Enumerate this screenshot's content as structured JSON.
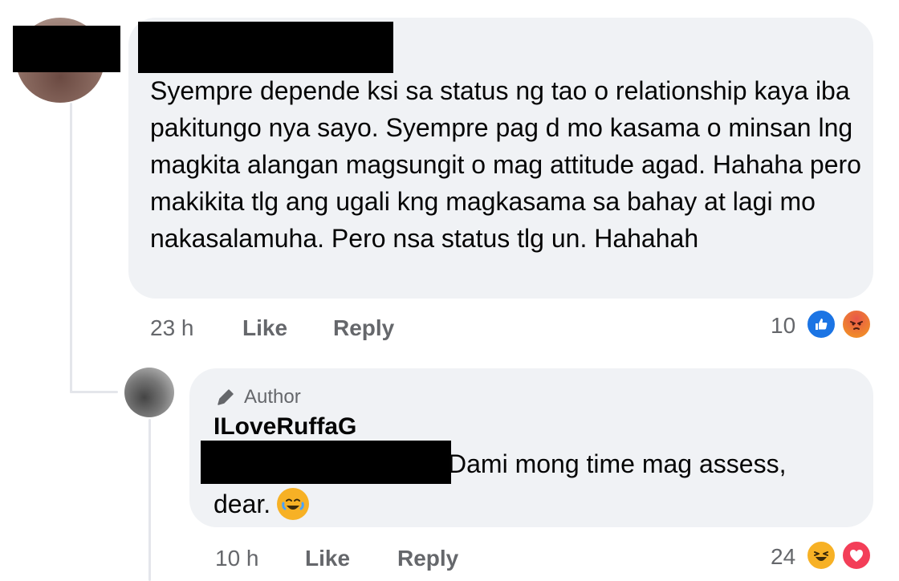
{
  "comment_1": {
    "text": "Syempre depende ksi sa status ng tao o relationship kaya iba pakitungo nya sayo. Syempre pag d mo kasama o minsan lng magkita alangan magsungit o mag attitude agad. Hahaha pero makikita tlg ang ugali kng magkasama sa bahay at lagi mo nakasalamuha. Pero nsa status tlg un. Hahahah",
    "time": "23 h",
    "like_label": "Like",
    "reply_label": "Reply",
    "reaction_count": "10",
    "reactions": [
      "like-icon",
      "angry-icon"
    ]
  },
  "reply_1": {
    "author_badge": "Author",
    "author_name": "ILoveRuffaG",
    "text_line1": "Dami mong time mag assess,",
    "text_line2": "dear.",
    "emoji": "laugh-cry-icon",
    "time": "10 h",
    "like_label": "Like",
    "reply_label": "Reply",
    "reaction_count": "24",
    "reactions": [
      "haha-icon",
      "love-icon"
    ]
  },
  "colors": {
    "bubble_bg": "#f0f2f5",
    "meta_text": "#65676b",
    "like_blue": "#1b74e4",
    "love_red": "#f33e58",
    "haha_yellow": "#f7b125"
  }
}
